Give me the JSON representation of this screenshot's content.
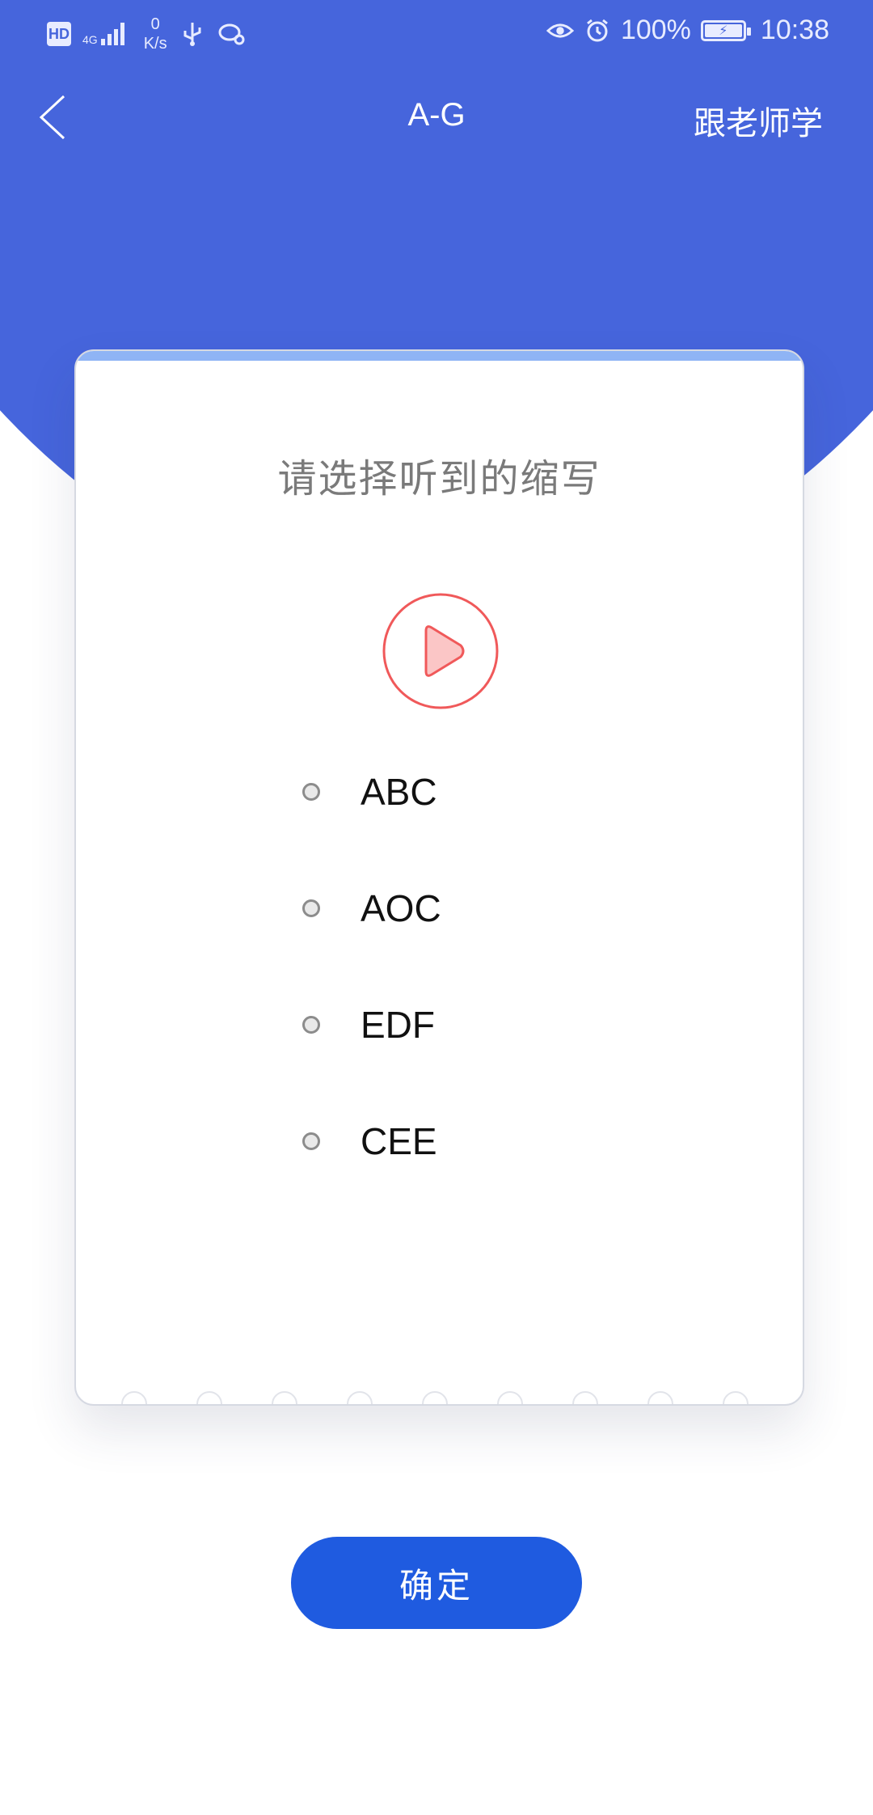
{
  "status_bar": {
    "hd": "HD",
    "network": "4G",
    "speed_value": "0",
    "speed_unit": "K/s",
    "battery": "100%",
    "time": "10:38"
  },
  "nav": {
    "title": "A-G",
    "right_action": "跟老师学"
  },
  "question": {
    "prompt": "请选择听到的缩写",
    "options": [
      "ABC",
      "AOC",
      "EDF",
      "CEE"
    ]
  },
  "confirm_label": "确定",
  "colors": {
    "header_blue": "#4665DC",
    "button_blue": "#1F5BE0",
    "play_red": "#F0595A"
  }
}
